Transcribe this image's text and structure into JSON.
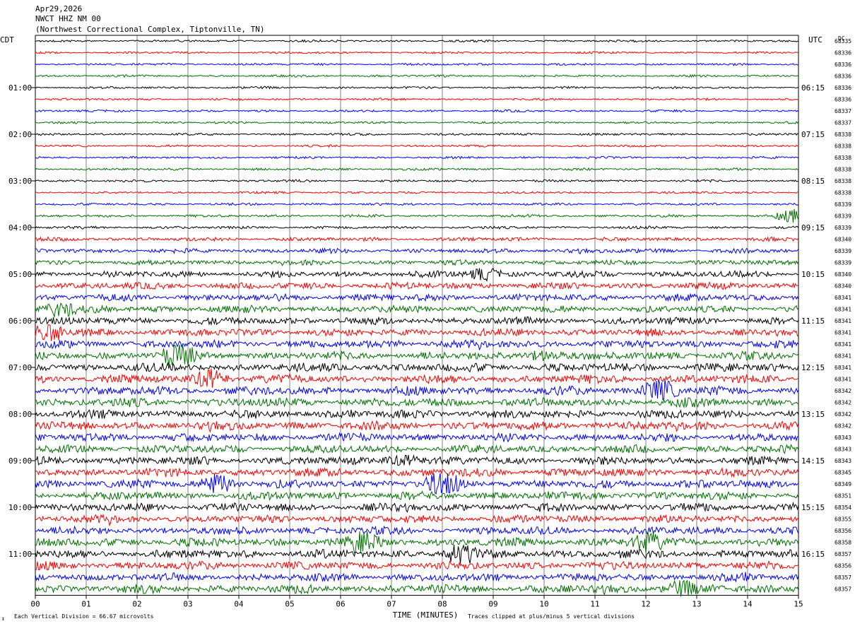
{
  "header": {
    "date": "Apr29,2026",
    "station": "NWCT HHZ NM 00",
    "location": "(Northwest Correctional Complex, Tiptonville, TN)"
  },
  "left_timezone": "CDT",
  "right_timezone": "UTC",
  "dc_label": "DC",
  "footer": {
    "scale_note": "Each Vertical Division =   66.67 microvolts",
    "clip_note": "Traces clipped at plus/minus 5 vertical divisions",
    "corner_mark": "↕"
  },
  "colors": {
    "trace_cycle": [
      "#000000",
      "#ff0000",
      "#0000ff",
      "#007000"
    ],
    "grid": "#808080",
    "frame": "#000000"
  },
  "chart_data": {
    "type": "line",
    "title": "Apr29,2026 NWCT HHZ NM 00 (Northwest Correctional Complex, Tiptonville, TN)",
    "xlabel": "TIME (MINUTES)",
    "ylabel": "",
    "xlim": [
      0,
      15
    ],
    "x_ticks": [
      "00",
      "01",
      "02",
      "03",
      "04",
      "05",
      "06",
      "07",
      "08",
      "09",
      "10",
      "11",
      "12",
      "13",
      "14",
      "15"
    ],
    "row_count": 48,
    "row_interval_minutes": 15,
    "grid": true,
    "left_hour_labels": [
      "01:00",
      "02:00",
      "03:00",
      "04:00",
      "05:00",
      "06:00",
      "07:00",
      "08:00",
      "09:00",
      "10:00",
      "11:00"
    ],
    "right_hour_labels": [
      "06:15",
      "07:15",
      "08:15",
      "09:15",
      "10:15",
      "11:15",
      "12:15",
      "13:15",
      "14:15",
      "15:15",
      "16:15"
    ],
    "hour_label_rows": [
      4,
      8,
      12,
      16,
      20,
      24,
      28,
      32,
      36,
      40,
      44
    ],
    "dc_offsets": [
      68335,
      68336,
      68336,
      68336,
      68336,
      68336,
      68337,
      68337,
      68338,
      68338,
      68338,
      68338,
      68338,
      68338,
      68339,
      68339,
      68339,
      68340,
      68339,
      68339,
      68340,
      68340,
      68341,
      68341,
      68341,
      68341,
      68341,
      68341,
      68341,
      68341,
      68342,
      68342,
      68342,
      68342,
      68343,
      68343,
      68343,
      68345,
      68349,
      68351,
      68354,
      68355,
      68356,
      68358,
      68357,
      68356,
      68357,
      68357
    ],
    "row_activity_level": [
      0.12,
      0.1,
      0.12,
      0.12,
      0.12,
      0.12,
      0.12,
      0.12,
      0.14,
      0.12,
      0.12,
      0.14,
      0.14,
      0.12,
      0.14,
      0.18,
      0.2,
      0.35,
      0.45,
      0.5,
      0.7,
      0.75,
      0.8,
      0.8,
      0.85,
      0.85,
      0.9,
      0.95,
      1.0,
      1.0,
      1.0,
      1.05,
      1.0,
      1.0,
      0.95,
      0.9,
      0.95,
      1.0,
      1.0,
      0.95,
      0.95,
      0.9,
      0.9,
      1.0,
      1.0,
      0.95,
      0.9,
      1.0
    ],
    "notable_bursts": [
      {
        "row": 15,
        "minute": 14.9,
        "amplitude": 1.6
      },
      {
        "row": 20,
        "minute": 8.8,
        "amplitude": 1.6
      },
      {
        "row": 23,
        "minute": 0.4,
        "amplitude": 2.0
      },
      {
        "row": 25,
        "minute": 0.3,
        "amplitude": 2.0
      },
      {
        "row": 27,
        "minute": 2.8,
        "amplitude": 2.2
      },
      {
        "row": 27,
        "minute": 10.0,
        "amplitude": 2.0
      },
      {
        "row": 29,
        "minute": 3.5,
        "amplitude": 2.4
      },
      {
        "row": 30,
        "minute": 12.3,
        "amplitude": 3.0
      },
      {
        "row": 36,
        "minute": 7.2,
        "amplitude": 2.2
      },
      {
        "row": 38,
        "minute": 3.6,
        "amplitude": 2.4
      },
      {
        "row": 38,
        "minute": 8.0,
        "amplitude": 2.0
      },
      {
        "row": 43,
        "minute": 6.5,
        "amplitude": 2.0
      },
      {
        "row": 43,
        "minute": 12.0,
        "amplitude": 1.8
      },
      {
        "row": 44,
        "minute": 8.3,
        "amplitude": 2.4
      },
      {
        "row": 47,
        "minute": 12.6,
        "amplitude": 2.0
      }
    ]
  }
}
